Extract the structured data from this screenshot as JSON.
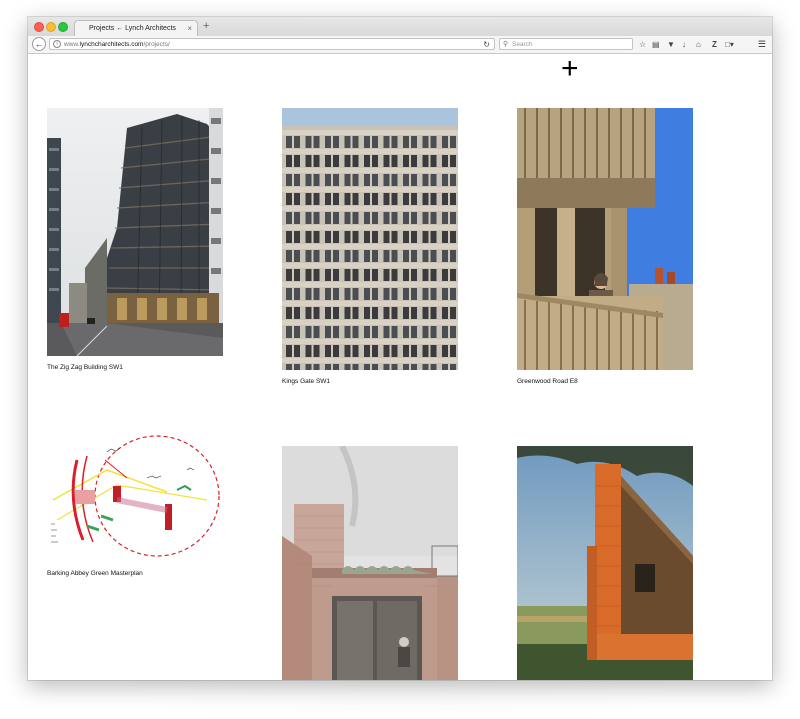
{
  "browser": {
    "tab_title": "Projects ← Lynch Architects",
    "tab_close": "×",
    "new_tab": "+",
    "url_prefix": "www.",
    "url_host": "lynchcharchitects.com",
    "url_path": "/projects/",
    "search_placeholder": "Search"
  },
  "site": {
    "logo": "+"
  },
  "projects": [
    {
      "title": "The Zig Zag Building SW1"
    },
    {
      "title": "Kings Gate SW1"
    },
    {
      "title": "Greenwood Road E8"
    },
    {
      "title": "Barking Abbey Green Masterplan"
    },
    {
      "title": ""
    },
    {
      "title": ""
    }
  ]
}
